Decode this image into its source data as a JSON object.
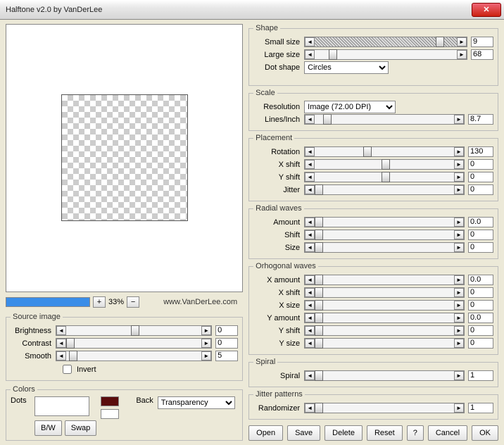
{
  "window": {
    "title": "Halftone v2.0 by VanDerLee",
    "close": "✕"
  },
  "zoom": {
    "plus": "+",
    "pct": "33%",
    "minus": "−",
    "url": "www.VanDerLee.com"
  },
  "source": {
    "legend": "Source image",
    "brightness_label": "Brightness",
    "brightness_val": "0",
    "contrast_label": "Contrast",
    "contrast_val": "0",
    "smooth_label": "Smooth",
    "smooth_val": "5",
    "invert_label": "Invert"
  },
  "colors": {
    "legend": "Colors",
    "dots_label": "Dots",
    "back_label": "Back",
    "back_value": "Transparency",
    "bw_btn": "B/W",
    "swap_btn": "Swap"
  },
  "shape": {
    "legend": "Shape",
    "small_label": "Small size",
    "small_val": "9",
    "large_label": "Large size",
    "large_val": "68",
    "dot_label": "Dot shape",
    "dot_value": "Circles"
  },
  "scale": {
    "legend": "Scale",
    "res_label": "Resolution",
    "res_value": "Image (72.00 DPI)",
    "lpi_label": "Lines/Inch",
    "lpi_val": "8.7"
  },
  "placement": {
    "legend": "Placement",
    "rotation_label": "Rotation",
    "rotation_val": "130",
    "xshift_label": "X shift",
    "xshift_val": "0",
    "yshift_label": "Y shift",
    "yshift_val": "0",
    "jitter_label": "Jitter",
    "jitter_val": "0"
  },
  "radial": {
    "legend": "Radial waves",
    "amount_label": "Amount",
    "amount_val": "0.0",
    "shift_label": "Shift",
    "shift_val": "0",
    "size_label": "Size",
    "size_val": "0"
  },
  "ortho": {
    "legend": "Orhogonal waves",
    "xamount_label": "X amount",
    "xamount_val": "0.0",
    "xshift_label": "X shift",
    "xshift_val": "0",
    "xsize_label": "X size",
    "xsize_val": "0",
    "yamount_label": "Y amount",
    "yamount_val": "0.0",
    "yshift_label": "Y shift",
    "yshift_val": "0",
    "ysize_label": "Y size",
    "ysize_val": "0"
  },
  "spiral": {
    "legend": "Spiral",
    "spiral_label": "Spiral",
    "spiral_val": "1"
  },
  "jitter": {
    "legend": "Jitter patterns",
    "rand_label": "Randomizer",
    "rand_val": "1"
  },
  "buttons": {
    "open": "Open",
    "save": "Save",
    "delete": "Delete",
    "reset": "Reset",
    "help": "?",
    "cancel": "Cancel",
    "ok": "OK"
  },
  "glyph": {
    "left": "◄",
    "right": "►"
  }
}
